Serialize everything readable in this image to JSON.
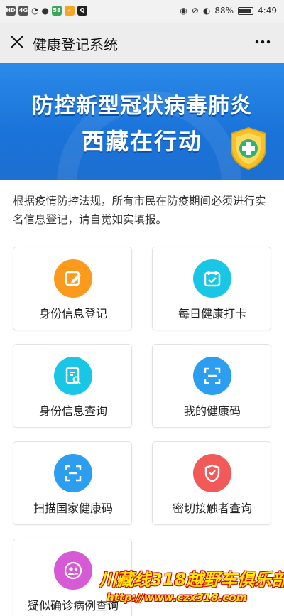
{
  "status_bar": {
    "left_chips": [
      "HD",
      "4G",
      "58",
      "✓"
    ],
    "battery_percent": "88%",
    "time": "4:49"
  },
  "header": {
    "title": "健康登记系统"
  },
  "banner": {
    "line1": "防控新型冠状病毒肺炎",
    "line2": "西藏在行动"
  },
  "notice": "根据疫情防控法规，所有市民在防疫期间必须进行实名信息登记，请自觉如实填报。",
  "cards": [
    {
      "label": "身份信息登记",
      "icon": "edit-icon",
      "color": "#fb9a1d"
    },
    {
      "label": "每日健康打卡",
      "icon": "calendar-check-icon",
      "color": "#19c6e6"
    },
    {
      "label": "身份信息查询",
      "icon": "document-search-icon",
      "color": "#19c6e6"
    },
    {
      "label": "我的健康码",
      "icon": "scan-icon",
      "color": "#2b9ef0"
    },
    {
      "label": "扫描国家健康码",
      "icon": "scan-icon",
      "color": "#2b9ef0"
    },
    {
      "label": "密切接触者查询",
      "icon": "shield-virus-icon",
      "color": "#f25a5a"
    },
    {
      "label": "疑似确诊病例查询",
      "icon": "people-icon",
      "color": "#d65ad6"
    }
  ],
  "watermark": {
    "line1": "川藏线318越野车俱乐部",
    "line2": "http://www.czx318.com"
  },
  "colors": {
    "header_bg": "#ededed",
    "banner_blue": "#1a73d9"
  }
}
